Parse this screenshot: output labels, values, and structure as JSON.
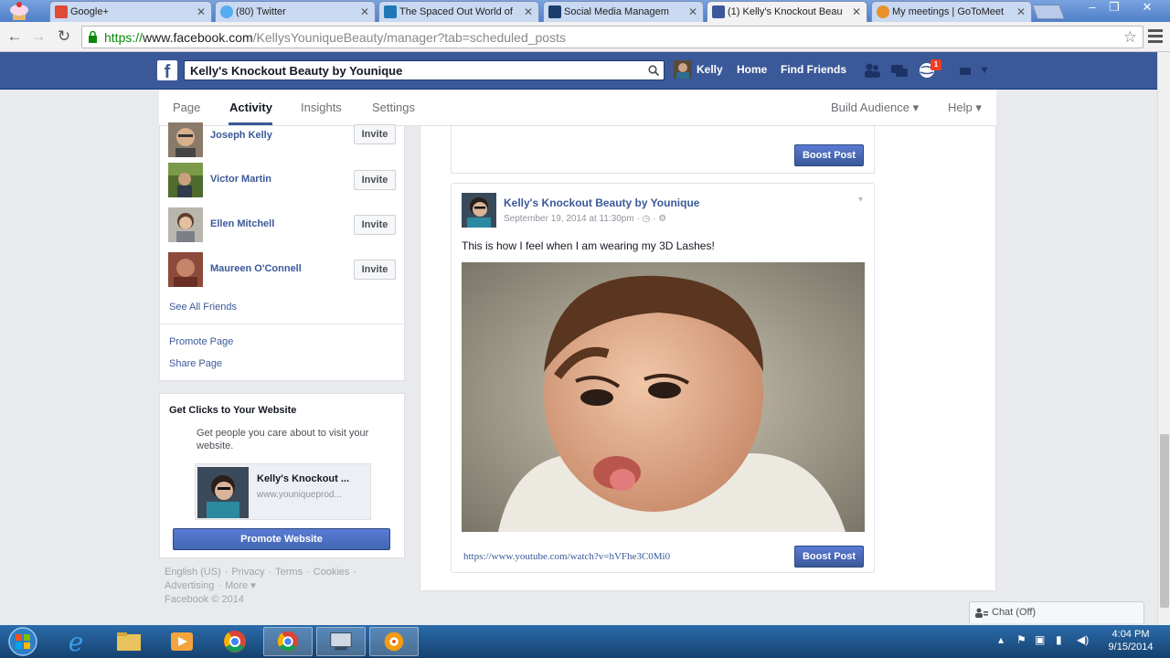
{
  "browser": {
    "tabs": [
      {
        "title": "Google+",
        "favicon_color": "#dd4b39"
      },
      {
        "title": "(80) Twitter",
        "favicon_color": "#55acee"
      },
      {
        "title": "The Spaced Out World of",
        "favicon_color": "#1f78b4"
      },
      {
        "title": "Social Media Managem",
        "favicon_color": "#1c3d6d"
      },
      {
        "title": "(1) Kelly's Knockout Beau",
        "favicon_color": "#3b5998"
      },
      {
        "title": "My meetings | GoToMeet",
        "favicon_color": "#e8912a"
      }
    ],
    "active_tab_index": 4,
    "url_scheme": "https://",
    "url_host": "www.facebook.com",
    "url_path": "/KellysYouniqueBeauty/manager?tab=scheduled_posts",
    "window_controls": [
      "–",
      "❐",
      "✕"
    ]
  },
  "fb": {
    "logo": "f",
    "search_value": "Kelly's Knockout Beauty by Younique",
    "user_name": "Kelly",
    "nav_home": "Home",
    "nav_find_friends": "Find Friends",
    "notif_count": "1",
    "brand_color": "#3b5998"
  },
  "page_nav": {
    "tabs": [
      "Page",
      "Activity",
      "Insights",
      "Settings"
    ],
    "active": "Activity",
    "build_audience": "Build Audience ▾",
    "help": "Help ▾"
  },
  "friends": [
    {
      "name": "Joseph Kelly",
      "action": "Invite"
    },
    {
      "name": "Victor Martin",
      "action": "Invite"
    },
    {
      "name": "Ellen Mitchell",
      "action": "Invite"
    },
    {
      "name": "Maureen O'Connell",
      "action": "Invite"
    }
  ],
  "left_links": {
    "see_all": "See All Friends",
    "promote_page": "Promote Page",
    "share_page": "Share Page"
  },
  "promo": {
    "title": "Get Clicks to Your Website",
    "description": "Get people you care about to visit your website.",
    "page_title": "Kelly's Knockout ...",
    "page_url": "www.youniqueprod...",
    "button": "Promote Website"
  },
  "footer": {
    "links": [
      "English (US)",
      "·",
      "Privacy",
      "·",
      "Terms",
      "·",
      "Cookies",
      "·",
      "Advertising",
      "·",
      "More ▾"
    ],
    "copyright": "Facebook © 2014"
  },
  "posts": {
    "prev_boost": "Boost Post",
    "author": "Kelly's Knockout Beauty by Younique",
    "date": "September 19, 2014 at 11:30pm · ◷ · ⚙",
    "text": "This is how I feel when I am wearing my 3D Lashes!",
    "link": "https://www.youtube.com/watch?v=hVFhe3C0Mi0",
    "boost": "Boost Post"
  },
  "chat": {
    "label": "Chat (Off)"
  },
  "taskbar": {
    "time": "4:04 PM",
    "date": "9/15/2014"
  }
}
